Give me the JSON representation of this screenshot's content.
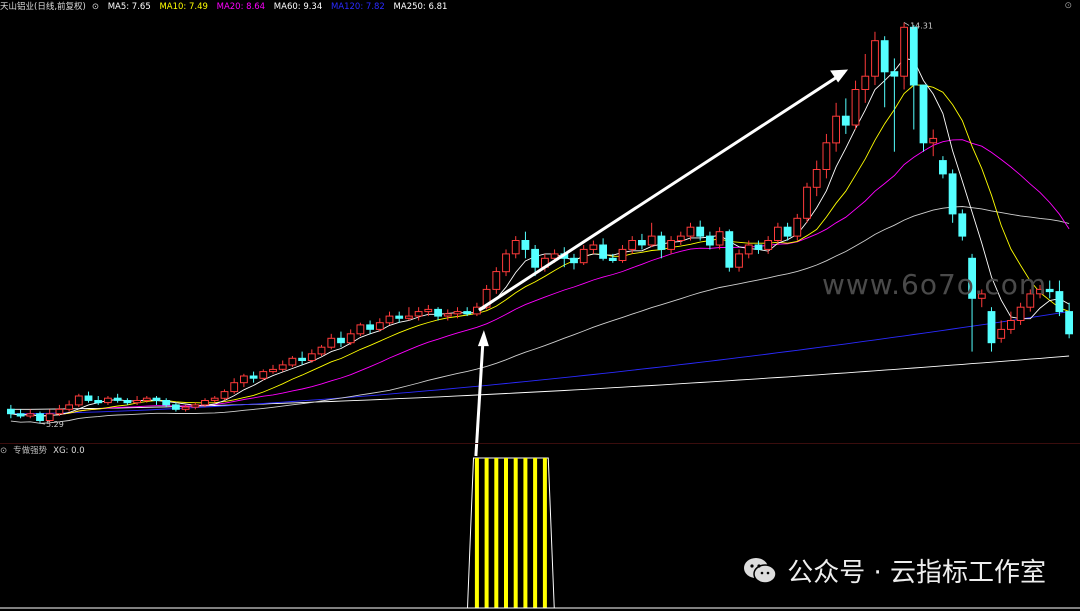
{
  "header": {
    "stock_name": "天山铝业",
    "period_label": "(日线,前复权)",
    "indicators": [
      {
        "label": "MA5: 7.65",
        "color": "#ffffff"
      },
      {
        "label": "MA10: 7.49",
        "color": "#ffff00"
      },
      {
        "label": "MA20: 8.64",
        "color": "#ff00ff"
      },
      {
        "label": "MA60: 9.34",
        "color": "#ffffff"
      },
      {
        "label": "MA120: 7.82",
        "color": "#2a2aff"
      },
      {
        "label": "MA250: 6.81",
        "color": "#ffffff"
      }
    ]
  },
  "sub_header": {
    "indicator_name": "专做强势",
    "value_label": "XG: 0.0"
  },
  "price_annotations": {
    "high_label": "14.31",
    "low_label": "5.29"
  },
  "watermark": "www.6o7o.com",
  "footer": {
    "text": "公众号 · 云指标工作室"
  },
  "colors": {
    "up": "#ff3b3b",
    "down": "#54ffff",
    "ma5": "#ffffff",
    "ma10": "#ffff00",
    "ma20": "#ff00ff",
    "ma60": "#cfcfcf",
    "ma120": "#2a2aff",
    "ma250": "#ffffff",
    "signal": "#ffff00"
  },
  "chart_data": {
    "type": "candlestick",
    "price_range": [
      5.0,
      14.5
    ],
    "candles": [
      [
        5.6,
        5.5,
        5.7,
        5.4
      ],
      [
        5.5,
        5.45,
        5.6,
        5.4
      ],
      [
        5.45,
        5.5,
        5.6,
        5.4
      ],
      [
        5.5,
        5.35,
        5.55,
        5.29
      ],
      [
        5.35,
        5.5,
        5.6,
        5.3
      ],
      [
        5.5,
        5.6,
        5.7,
        5.45
      ],
      [
        5.6,
        5.7,
        5.8,
        5.55
      ],
      [
        5.7,
        5.9,
        5.95,
        5.65
      ],
      [
        5.9,
        5.8,
        6.0,
        5.75
      ],
      [
        5.8,
        5.75,
        5.9,
        5.7
      ],
      [
        5.75,
        5.85,
        5.9,
        5.7
      ],
      [
        5.85,
        5.8,
        5.95,
        5.75
      ],
      [
        5.8,
        5.75,
        5.85,
        5.7
      ],
      [
        5.75,
        5.8,
        5.9,
        5.7
      ],
      [
        5.8,
        5.85,
        5.9,
        5.75
      ],
      [
        5.85,
        5.8,
        5.9,
        5.7
      ],
      [
        5.8,
        5.7,
        5.85,
        5.65
      ],
      [
        5.7,
        5.6,
        5.75,
        5.55
      ],
      [
        5.6,
        5.65,
        5.7,
        5.55
      ],
      [
        5.65,
        5.7,
        5.75,
        5.6
      ],
      [
        5.7,
        5.8,
        5.85,
        5.65
      ],
      [
        5.8,
        5.85,
        5.9,
        5.75
      ],
      [
        5.85,
        6.0,
        6.05,
        5.8
      ],
      [
        6.0,
        6.2,
        6.3,
        5.95
      ],
      [
        6.2,
        6.35,
        6.4,
        6.1
      ],
      [
        6.35,
        6.3,
        6.45,
        6.2
      ],
      [
        6.3,
        6.45,
        6.5,
        6.25
      ],
      [
        6.45,
        6.5,
        6.6,
        6.4
      ],
      [
        6.5,
        6.6,
        6.7,
        6.45
      ],
      [
        6.6,
        6.75,
        6.8,
        6.55
      ],
      [
        6.75,
        6.7,
        6.9,
        6.6
      ],
      [
        6.7,
        6.85,
        6.95,
        6.65
      ],
      [
        6.85,
        7.0,
        7.05,
        6.8
      ],
      [
        7.0,
        7.2,
        7.3,
        6.95
      ],
      [
        7.2,
        7.1,
        7.35,
        7.0
      ],
      [
        7.1,
        7.3,
        7.4,
        7.05
      ],
      [
        7.3,
        7.5,
        7.55,
        7.25
      ],
      [
        7.5,
        7.4,
        7.6,
        7.3
      ],
      [
        7.4,
        7.55,
        7.65,
        7.35
      ],
      [
        7.55,
        7.7,
        7.8,
        7.5
      ],
      [
        7.7,
        7.65,
        7.8,
        7.55
      ],
      [
        7.65,
        7.7,
        7.9,
        7.6
      ],
      [
        7.7,
        7.8,
        7.9,
        7.6
      ],
      [
        7.8,
        7.85,
        7.95,
        7.7
      ],
      [
        7.85,
        7.7,
        7.9,
        7.6
      ],
      [
        7.7,
        7.75,
        7.85,
        7.6
      ],
      [
        7.75,
        7.8,
        7.9,
        7.65
      ],
      [
        7.8,
        7.75,
        7.9,
        7.7
      ],
      [
        7.75,
        7.9,
        8.0,
        7.7
      ],
      [
        7.9,
        8.3,
        8.4,
        7.85
      ],
      [
        8.3,
        8.7,
        8.8,
        8.2
      ],
      [
        8.7,
        9.1,
        9.2,
        8.6
      ],
      [
        9.1,
        9.4,
        9.5,
        9.0
      ],
      [
        9.4,
        9.2,
        9.6,
        9.0
      ],
      [
        9.2,
        8.8,
        9.3,
        8.6
      ],
      [
        8.8,
        9.0,
        9.1,
        8.7
      ],
      [
        9.0,
        9.1,
        9.2,
        8.9
      ],
      [
        9.1,
        9.0,
        9.25,
        8.8
      ],
      [
        9.0,
        8.9,
        9.1,
        8.75
      ],
      [
        8.9,
        9.2,
        9.3,
        8.85
      ],
      [
        9.2,
        9.3,
        9.4,
        9.1
      ],
      [
        9.3,
        9.0,
        9.45,
        8.95
      ],
      [
        9.0,
        8.95,
        9.1,
        8.9
      ],
      [
        8.95,
        9.2,
        9.3,
        8.9
      ],
      [
        9.2,
        9.4,
        9.5,
        9.1
      ],
      [
        9.4,
        9.3,
        9.55,
        9.2
      ],
      [
        9.3,
        9.5,
        9.8,
        9.25
      ],
      [
        9.5,
        9.2,
        9.6,
        9.0
      ],
      [
        9.2,
        9.4,
        9.5,
        9.1
      ],
      [
        9.4,
        9.5,
        9.6,
        9.3
      ],
      [
        9.5,
        9.7,
        9.8,
        9.4
      ],
      [
        9.7,
        9.5,
        9.85,
        9.4
      ],
      [
        9.5,
        9.3,
        9.6,
        9.2
      ],
      [
        9.3,
        9.6,
        9.7,
        9.2
      ],
      [
        9.6,
        8.8,
        9.65,
        8.7
      ],
      [
        8.8,
        9.1,
        9.2,
        8.7
      ],
      [
        9.1,
        9.3,
        9.4,
        9.0
      ],
      [
        9.3,
        9.2,
        9.4,
        9.1
      ],
      [
        9.2,
        9.4,
        9.5,
        9.1
      ],
      [
        9.4,
        9.7,
        9.8,
        9.3
      ],
      [
        9.7,
        9.5,
        9.8,
        9.4
      ],
      [
        9.5,
        9.9,
        10.0,
        9.4
      ],
      [
        9.9,
        10.6,
        10.7,
        9.8
      ],
      [
        10.6,
        11.0,
        11.2,
        10.4
      ],
      [
        11.0,
        11.6,
        11.8,
        10.8
      ],
      [
        11.6,
        12.2,
        12.5,
        11.4
      ],
      [
        12.2,
        12.0,
        12.6,
        11.8
      ],
      [
        12.0,
        12.8,
        13.0,
        11.9
      ],
      [
        12.8,
        13.1,
        13.6,
        12.5
      ],
      [
        13.1,
        13.9,
        14.1,
        12.9
      ],
      [
        13.9,
        13.2,
        14.0,
        12.4
      ],
      [
        13.2,
        13.1,
        13.5,
        11.4
      ],
      [
        13.1,
        14.2,
        14.31,
        12.8
      ],
      [
        14.2,
        12.9,
        14.25,
        11.9
      ],
      [
        12.9,
        11.6,
        12.9,
        11.4
      ],
      [
        11.6,
        11.7,
        11.9,
        11.3
      ],
      [
        11.2,
        10.9,
        11.3,
        10.8
      ],
      [
        10.9,
        10.0,
        11.0,
        9.8
      ],
      [
        10.0,
        9.5,
        10.1,
        9.4
      ],
      [
        9.0,
        8.1,
        9.1,
        6.9
      ],
      [
        8.1,
        8.2,
        8.3,
        7.9
      ],
      [
        7.8,
        7.1,
        7.9,
        6.9
      ],
      [
        7.2,
        7.4,
        7.6,
        7.1
      ],
      [
        7.4,
        7.6,
        7.8,
        7.3
      ],
      [
        7.6,
        7.9,
        8.0,
        7.5
      ],
      [
        7.9,
        8.2,
        8.3,
        7.8
      ],
      [
        8.2,
        8.3,
        8.4,
        8.1
      ],
      [
        8.3,
        8.25,
        8.5,
        8.1
      ],
      [
        8.25,
        7.8,
        8.5,
        7.7
      ],
      [
        7.8,
        7.3,
        8.0,
        7.2
      ]
    ],
    "signal_bars": {
      "start_index": 48,
      "end_index": 55
    }
  }
}
